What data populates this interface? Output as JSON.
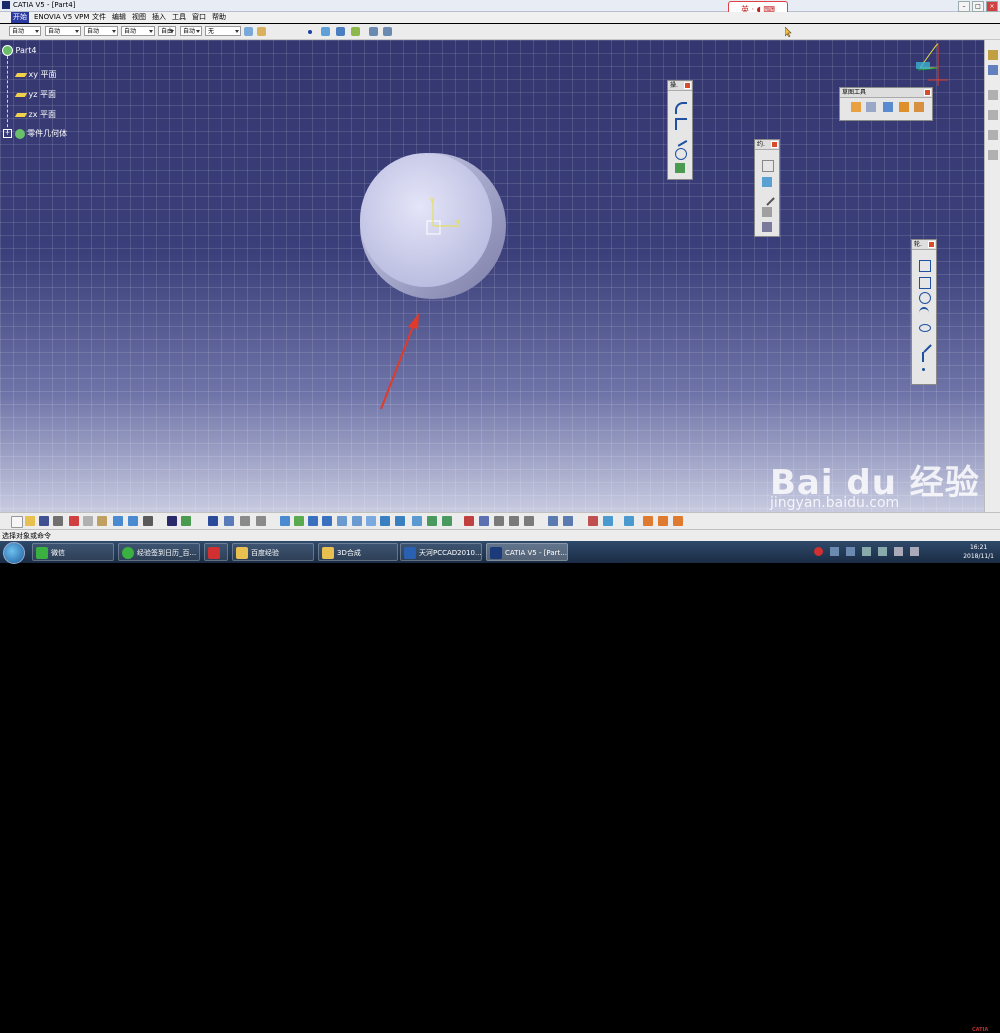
{
  "window": {
    "title": "CATIA V5 - [Part4]"
  },
  "ime": {
    "label": "英"
  },
  "menu": {
    "items": [
      "开始",
      "ENOVIA V5 VPM",
      "文件",
      "编辑",
      "视图",
      "插入",
      "工具",
      "窗口",
      "帮助"
    ]
  },
  "toolbar": {
    "dropdowns": [
      "自动",
      "自动",
      "自动",
      "自动",
      "自由",
      "自动",
      "无"
    ]
  },
  "tree": {
    "root": "Part4",
    "nodes": [
      "xy 平面",
      "yz 平面",
      "zx 平面",
      "零件几何体"
    ]
  },
  "panels": {
    "sketch_tools_title": "草图工具",
    "ops_title": "操.",
    "constraint_title": "约.",
    "profile_title": "轮."
  },
  "status": {
    "text": "选择对象或命令"
  },
  "taskbar": {
    "tasks": [
      "微信",
      "经验签到日历_百...",
      "",
      "百度经验",
      "3D合成",
      "天河PCCAD2010...",
      "CATIA V5 - [Part..."
    ],
    "time": "16:21",
    "date": "2018/11/1"
  },
  "watermark": {
    "brand": "Bai du 经验",
    "url": "jingyan.baidu.com"
  },
  "logo": {
    "text": "CATIA"
  },
  "colors": {
    "viewport_top": "#34366f",
    "viewport_bottom": "#c8cbe0",
    "disc_fill": "#cfd1ef",
    "arrow": "#e03a2a",
    "plane_icon": "#f1d04a",
    "menu_active": "#2a3aa0"
  }
}
